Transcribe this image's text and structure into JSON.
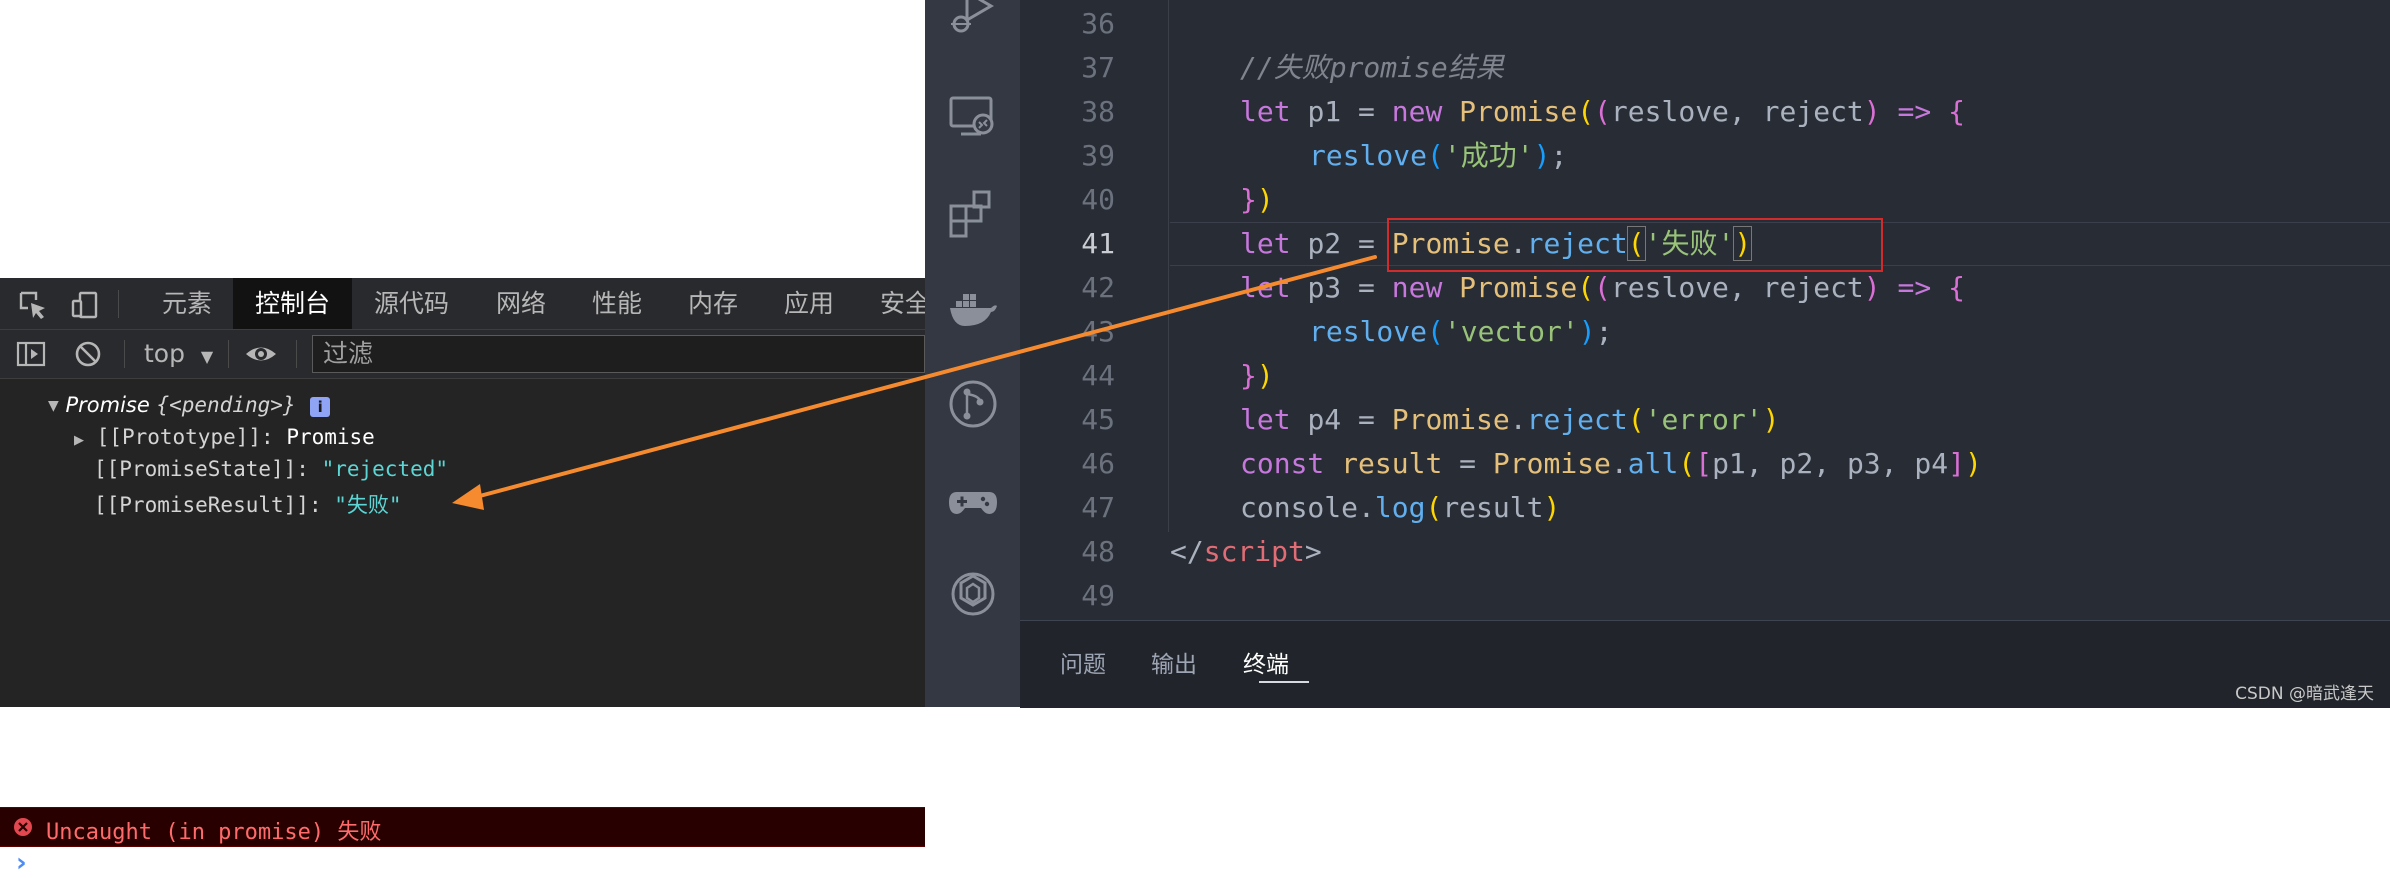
{
  "devtools": {
    "tabs": [
      "元素",
      "控制台",
      "源代码",
      "网络",
      "性能",
      "内存",
      "应用",
      "安全"
    ],
    "active_tab": "控制台",
    "context": "top",
    "filter_placeholder": "过滤",
    "console": {
      "promise_label": "Promise",
      "pending_text": "{<pending>}",
      "info_badge": "i",
      "prototype_key": "[[Prototype]]",
      "prototype_value": "Promise",
      "state_key": "[[PromiseState]]",
      "state_value": "\"rejected\"",
      "result_key": "[[PromiseResult]]",
      "result_value": "\"失败\"",
      "error_text": "Uncaught (in promise)",
      "error_value": "失败",
      "prompt": "›"
    }
  },
  "editor": {
    "line_numbers": [
      "36",
      "37",
      "38",
      "39",
      "40",
      "41",
      "42",
      "43",
      "44",
      "45",
      "46",
      "47",
      "48",
      "49"
    ],
    "current_line": "41",
    "lines": {
      "l37_comment": "//失败promise结果",
      "let": "let",
      "new": "new",
      "const": "const",
      "Promise": "Promise",
      "arrow": "=>",
      "p1": "p1",
      "p2": "p2",
      "p3": "p3",
      "p4": "p4",
      "result": "result",
      "reslove": "reslove",
      "reject": "reject",
      "all": "all",
      "console": "console",
      "log": "log",
      "str_success": "'成功'",
      "str_fail": "'失败'",
      "str_vector": "'vector'",
      "str_error": "'error'",
      "script_tag": "script"
    }
  },
  "panel": {
    "tabs": [
      "问题",
      "输出",
      "终端"
    ],
    "active_tab": "终端"
  },
  "watermark": "CSDN @暗武逢天",
  "colors": {
    "annotation_arrow": "#f58a2e",
    "annotation_box": "#d22b2b",
    "error_text": "#ff6b6b"
  }
}
